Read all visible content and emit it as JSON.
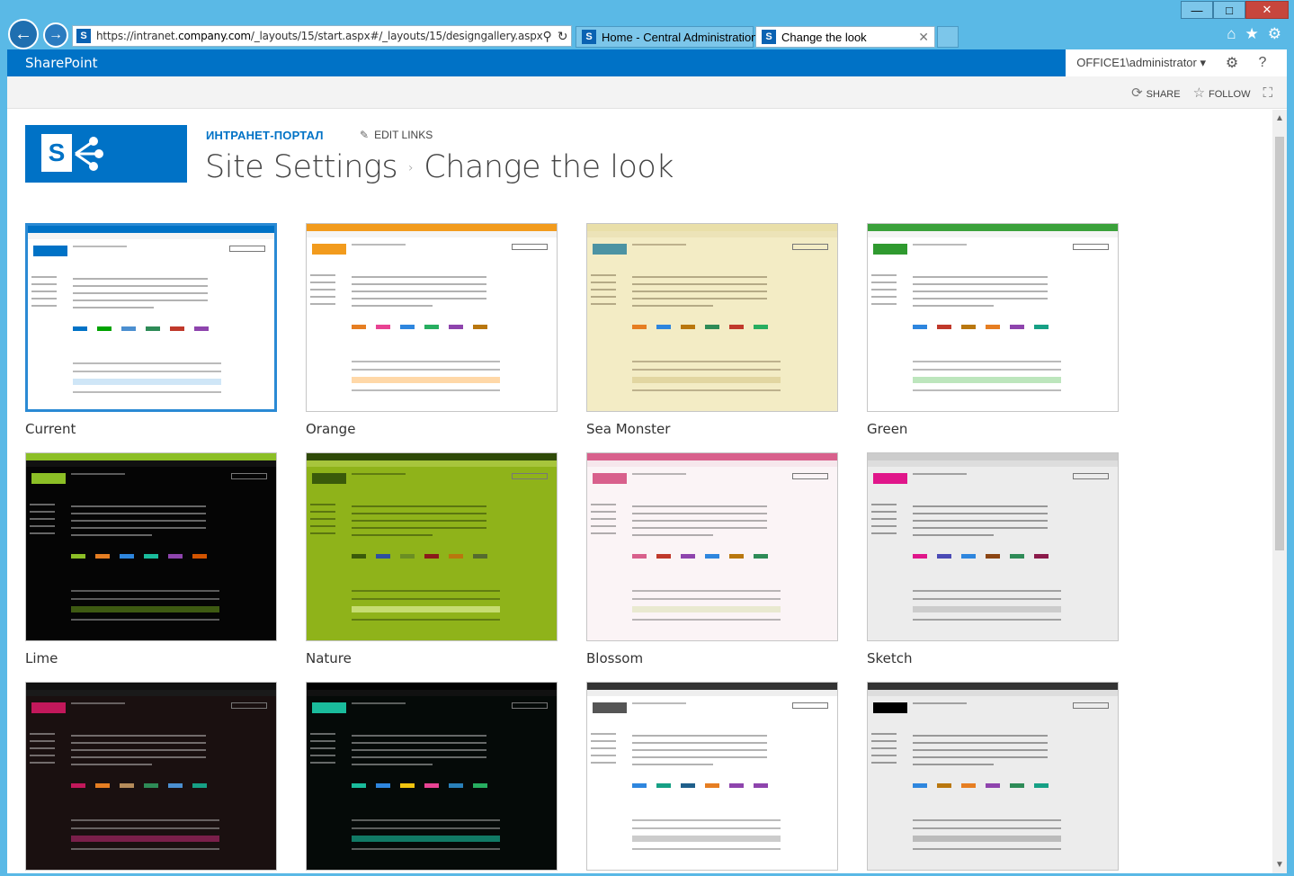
{
  "browser": {
    "url_prefix": "https://intranet.",
    "url_domain": "company.com",
    "url_rest": "/_layouts/15/start.aspx#/_layouts/15/designgallery.aspx",
    "tabs": [
      {
        "label": "Home - Central Administration"
      },
      {
        "label": "Change the look"
      }
    ],
    "window_controls": {
      "minimize": "—",
      "maximize": "□",
      "close": "✕"
    }
  },
  "suite": {
    "brand": "SharePoint",
    "user": "OFFICE1\\administrator ▾"
  },
  "ribbon": {
    "share": "SHARE",
    "follow": "FOLLOW"
  },
  "site": {
    "title_link": "ИНТРАНЕТ-ПОРТАЛ",
    "edit_links": "EDIT LINKS",
    "breadcrumb_parent": "Site Settings",
    "breadcrumb_sep": "›",
    "page_title": "Change the look"
  },
  "themes": [
    {
      "name": "Current",
      "selected": true,
      "bg": "#ffffff",
      "top": "#0072c6",
      "nav": "#f4f4f4",
      "logo": "#0072c6",
      "text": "#555555",
      "title": "#555555",
      "hl": "#cfe6f7",
      "swatches": [
        "#0072c6",
        "#00a300",
        "#4b8fd0",
        "#2e8b57",
        "#c0392b",
        "#8e44ad"
      ]
    },
    {
      "name": "Orange",
      "selected": false,
      "bg": "#ffffff",
      "top": "#f29b1d",
      "nav": "#f4f4f4",
      "logo": "#f29b1d",
      "text": "#555555",
      "title": "#555555",
      "hl": "#ffd8a8",
      "swatches": [
        "#e67e22",
        "#e84393",
        "#2e86de",
        "#27ae60",
        "#8e44ad",
        "#b9770e"
      ]
    },
    {
      "name": "Sea Monster",
      "selected": false,
      "bg": "#f3ecc5",
      "top": "#e9dfa9",
      "nav": "#ece3b8",
      "logo": "#4c93a3",
      "text": "#6b5a3a",
      "title": "#6b5a3a",
      "hl": "#e2d6a1",
      "swatches": [
        "#e67e22",
        "#2e86de",
        "#b9770e",
        "#2e8b57",
        "#c0392b",
        "#27ae60"
      ]
    },
    {
      "name": "Green",
      "selected": false,
      "bg": "#ffffff",
      "top": "#3aa13a",
      "nav": "#f4f4f4",
      "logo": "#2f9a2f",
      "text": "#555555",
      "title": "#555555",
      "hl": "#bde6bd",
      "swatches": [
        "#2e86de",
        "#c0392b",
        "#b9770e",
        "#e67e22",
        "#8e44ad",
        "#16a085"
      ]
    },
    {
      "name": "Lime",
      "selected": false,
      "bg": "#050505",
      "top": "#8cbf26",
      "nav": "#111111",
      "logo": "#8cbf26",
      "text": "#dddddd",
      "title": "#dddddd",
      "hl": "#3e5a12",
      "swatches": [
        "#8cbf26",
        "#e67e22",
        "#2e86de",
        "#1abc9c",
        "#8e44ad",
        "#d35400"
      ]
    },
    {
      "name": "Nature",
      "selected": false,
      "bg": "#8fb31a",
      "top": "#2f4a08",
      "nav": "#a7c53c",
      "logo": "#3a5a0a",
      "text": "#1c2d04",
      "title": "#1c2d04",
      "hl": "#c6dc72",
      "swatches": [
        "#3a5a0a",
        "#2e4fa0",
        "#6b8e23",
        "#8b1a1a",
        "#b9770e",
        "#556b2f"
      ]
    },
    {
      "name": "Blossom",
      "selected": false,
      "bg": "#fbf4f6",
      "top": "#d8608c",
      "nav": "#f6e7ec",
      "logo": "#d8608c",
      "text": "#555555",
      "title": "#555555",
      "hl": "#e9e9d0",
      "swatches": [
        "#d8608c",
        "#c0392b",
        "#8e44ad",
        "#2e86de",
        "#b9770e",
        "#2e8b57"
      ]
    },
    {
      "name": "Sketch",
      "selected": false,
      "bg": "#ececec",
      "top": "#cccccc",
      "nav": "#dddddd",
      "logo": "#e0168a",
      "text": "#333333",
      "title": "#e0168a",
      "hl": "#cccccc",
      "swatches": [
        "#e0168a",
        "#4b4bb5",
        "#2e86de",
        "#8b4513",
        "#2e8b57",
        "#8b1a4a"
      ]
    },
    {
      "name": "",
      "selected": false,
      "bg": "#1a1010",
      "top": "#111111",
      "nav": "#1a1a1a",
      "logo": "#c2185b",
      "text": "#dddddd",
      "title": "#c2185b",
      "hl": "#7a1f4a",
      "swatches": [
        "#c2185b",
        "#e67e22",
        "#b58b5a",
        "#2e8b57",
        "#4b8fd0",
        "#16a085"
      ]
    },
    {
      "name": "",
      "selected": false,
      "bg": "#050a08",
      "top": "#000000",
      "nav": "#111111",
      "logo": "#1abc9c",
      "text": "#dddddd",
      "title": "#dddddd",
      "hl": "#117a65",
      "swatches": [
        "#1abc9c",
        "#2e86de",
        "#f1c40f",
        "#e84393",
        "#2980b9",
        "#27ae60"
      ]
    },
    {
      "name": "",
      "selected": false,
      "bg": "#ffffff",
      "top": "#333333",
      "nav": "#eeeeee",
      "logo": "#555555",
      "text": "#555555",
      "title": "#555555",
      "hl": "#cccccc",
      "swatches": [
        "#2e86de",
        "#16a085",
        "#1f5f8b",
        "#e67e22",
        "#8e44ad",
        "#8e44ad"
      ]
    },
    {
      "name": "",
      "selected": false,
      "bg": "#ececec",
      "top": "#333333",
      "nav": "#dddddd",
      "logo": "#000000",
      "text": "#333333",
      "title": "#333333",
      "hl": "#bbbbbb",
      "swatches": [
        "#2e86de",
        "#b9770e",
        "#e67e22",
        "#8e44ad",
        "#2e8b57",
        "#16a085"
      ]
    }
  ]
}
